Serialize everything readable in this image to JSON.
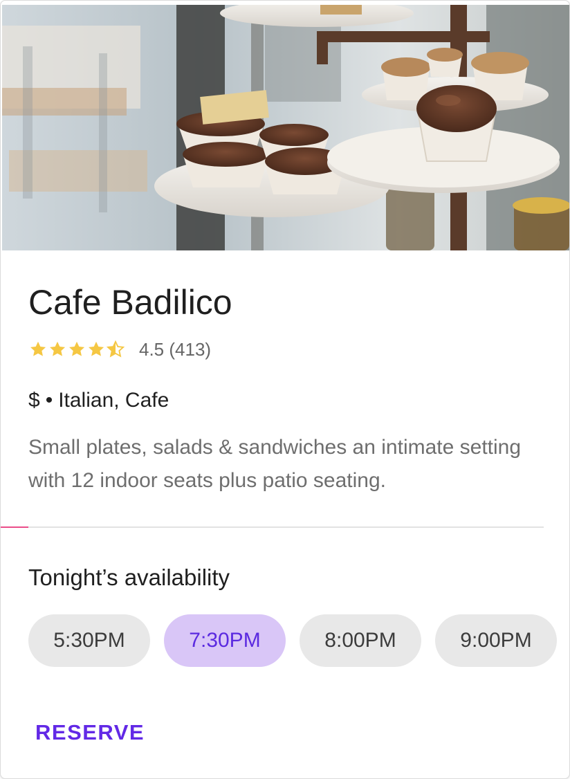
{
  "restaurant": {
    "name": "Cafe Badilico",
    "rating": 4.5,
    "rating_text": "4.5 (413)",
    "price": "$",
    "separator": "•",
    "cuisine": "Italian, Cafe",
    "description": "Small plates, salads & sandwiches an intimate setting with 12 indoor seats plus patio seating.",
    "hero_image": "cupcakes-on-marble-stand-photo"
  },
  "availability": {
    "title": "Tonight’s availability",
    "times": [
      "5:30PM",
      "7:30PM",
      "8:00PM",
      "9:00PM"
    ],
    "selected": "7:30PM"
  },
  "actions": {
    "reserve_label": "RESERVE"
  },
  "colors": {
    "star": "#f5c743",
    "accent": "#6229e6",
    "selected_chip_bg": "#d9c6f7",
    "chip_bg": "#e8e8e8",
    "divider_accent": "#ea4c89"
  }
}
